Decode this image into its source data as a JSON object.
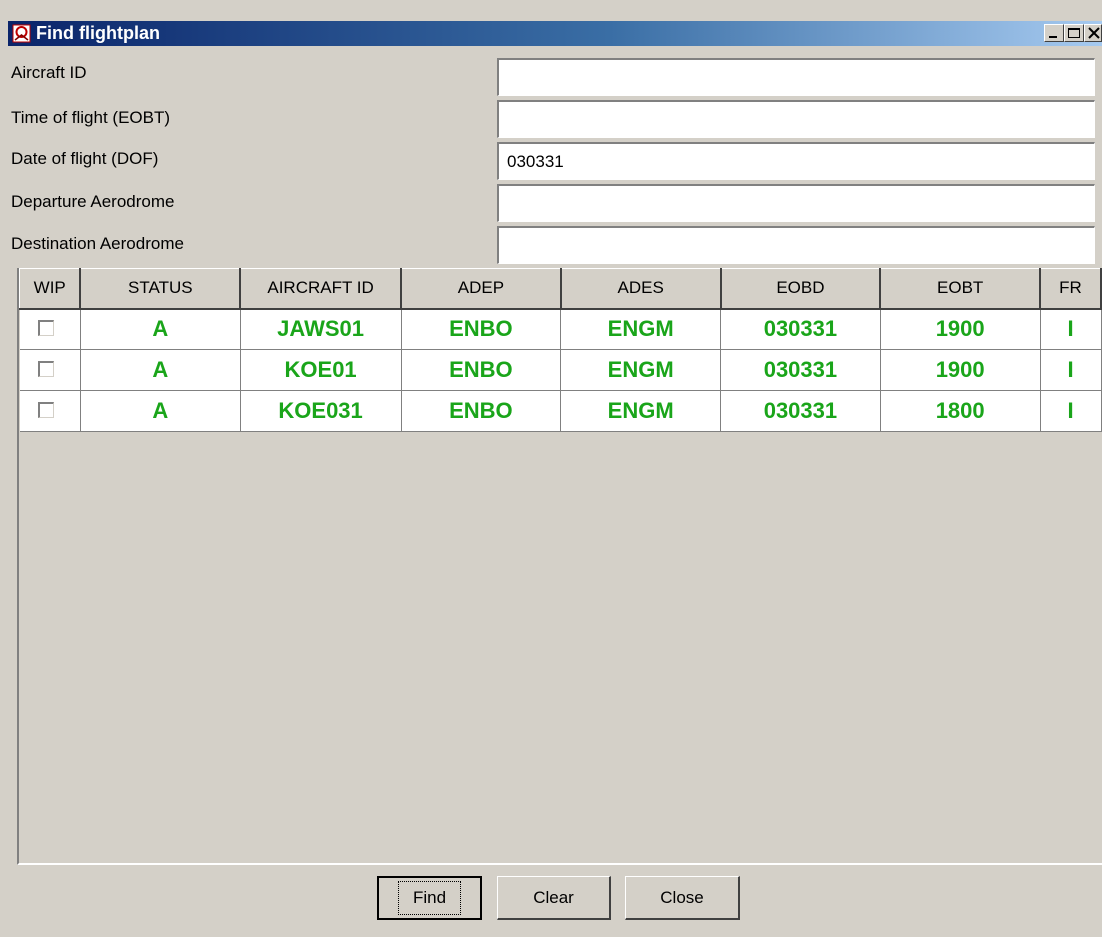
{
  "window": {
    "title": "Find flightplan",
    "controls": [
      "minimize",
      "maximize",
      "close"
    ]
  },
  "form": {
    "fields": [
      {
        "label": "Aircraft ID",
        "value": ""
      },
      {
        "label": "Time of flight (EOBT)",
        "value": ""
      },
      {
        "label": "Date of flight (DOF)",
        "value": "030331"
      },
      {
        "label": "Departure Aerodrome",
        "value": ""
      },
      {
        "label": "Destination Aerodrome",
        "value": ""
      }
    ]
  },
  "table": {
    "columns": [
      "WIP",
      "STATUS",
      "AIRCRAFT ID",
      "ADEP",
      "ADES",
      "EOBD",
      "EOBT",
      "FR"
    ],
    "rows": [
      {
        "wip": false,
        "status": "A",
        "aircraft_id": "JAWS01",
        "adep": "ENBO",
        "ades": "ENGM",
        "eobd": "030331",
        "eobt": "1900",
        "fr": "I"
      },
      {
        "wip": false,
        "status": "A",
        "aircraft_id": "KOE01",
        "adep": "ENBO",
        "ades": "ENGM",
        "eobd": "030331",
        "eobt": "1900",
        "fr": "I"
      },
      {
        "wip": false,
        "status": "A",
        "aircraft_id": "KOE031",
        "adep": "ENBO",
        "ades": "ENGM",
        "eobd": "030331",
        "eobt": "1800",
        "fr": "I"
      }
    ],
    "value_color": "#1aa51a"
  },
  "buttons": {
    "find": "Find",
    "clear": "Clear",
    "close": "Close"
  },
  "colors": {
    "title_gradient_start": "#0a246a",
    "title_gradient_end": "#a6caf0",
    "window_bg": "#d4d0c8"
  }
}
